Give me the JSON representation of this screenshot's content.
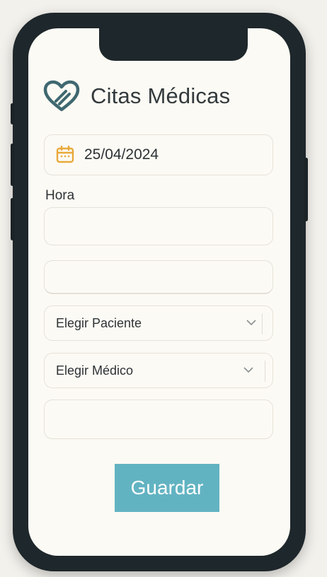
{
  "app": {
    "title": "Citas Médicas"
  },
  "form": {
    "date_value": "25/04/2024",
    "hora_label": "Hora",
    "hora_value": "",
    "patient_select": "Elegir Paciente",
    "doctor_select": "Elegir Médico",
    "save_label": "Guardar"
  },
  "icons": {
    "logo": "heart-stethoscope-icon",
    "calendar": "calendar-icon",
    "chevron": "chevron-down-icon"
  },
  "colors": {
    "accent": "#62b3c2",
    "logo": "#3f6870",
    "calendar": "#e8a93a",
    "screen_bg": "#fcfaf4"
  }
}
